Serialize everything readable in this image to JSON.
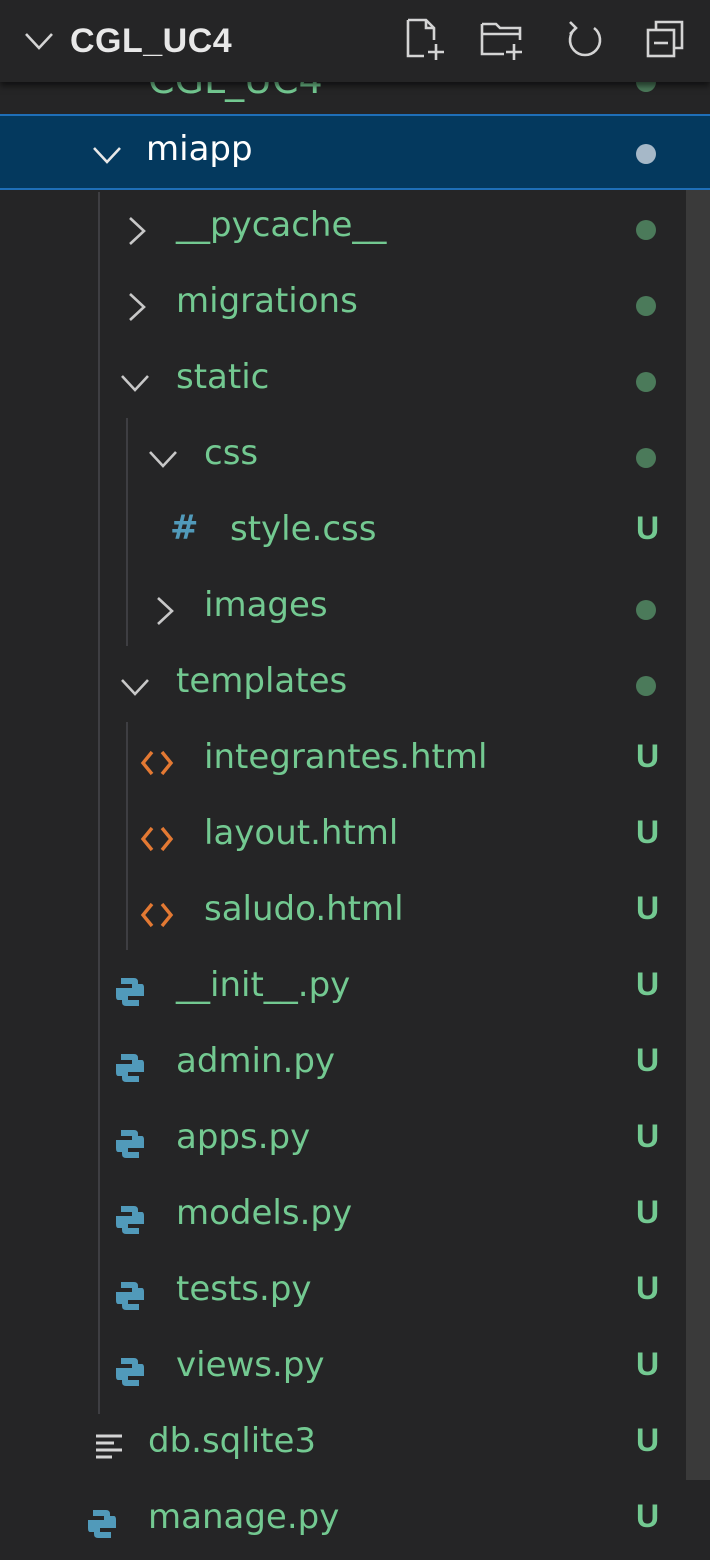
{
  "explorer": {
    "root_title": "CGL_UC4",
    "actions": [
      "new-file-icon",
      "new-folder-icon",
      "refresh-icon",
      "collapse-all-icon"
    ]
  },
  "partial_row": {
    "label": "CGL_UC4"
  },
  "tree": [
    {
      "label": "miapp",
      "kind": "folder-open",
      "status": "dot"
    },
    {
      "label": "__pycache__",
      "kind": "folder-closed",
      "status": "dot"
    },
    {
      "label": "migrations",
      "kind": "folder-closed",
      "status": "dot"
    },
    {
      "label": "static",
      "kind": "folder-open",
      "status": "dot"
    },
    {
      "label": "css",
      "kind": "folder-open",
      "status": "dot"
    },
    {
      "label": "style.css",
      "kind": "css-file",
      "status": "U"
    },
    {
      "label": "images",
      "kind": "folder-closed",
      "status": "dot"
    },
    {
      "label": "templates",
      "kind": "folder-open",
      "status": "dot"
    },
    {
      "label": "integrantes.html",
      "kind": "html-file",
      "status": "U"
    },
    {
      "label": "layout.html",
      "kind": "html-file",
      "status": "U"
    },
    {
      "label": "saludo.html",
      "kind": "html-file",
      "status": "U"
    },
    {
      "label": "__init__.py",
      "kind": "python-file",
      "status": "U"
    },
    {
      "label": "admin.py",
      "kind": "python-file",
      "status": "U"
    },
    {
      "label": "apps.py",
      "kind": "python-file",
      "status": "U"
    },
    {
      "label": "models.py",
      "kind": "python-file",
      "status": "U"
    },
    {
      "label": "tests.py",
      "kind": "python-file",
      "status": "U"
    },
    {
      "label": "views.py",
      "kind": "python-file",
      "status": "U"
    },
    {
      "label": "db.sqlite3",
      "kind": "text-file",
      "status": "U"
    },
    {
      "label": "manage.py",
      "kind": "python-file",
      "status": "U"
    }
  ],
  "colors": {
    "background": "#252526",
    "selected": "#04395e",
    "untracked_green": "#73c991",
    "html_icon": "#e37933",
    "python_icon": "#519aba"
  }
}
